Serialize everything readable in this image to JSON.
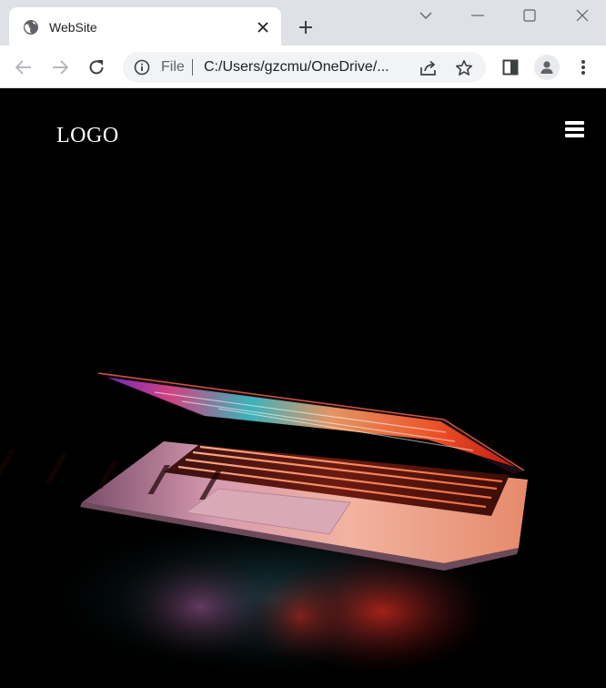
{
  "browser": {
    "tab_title": "WebSite",
    "omnibox_scheme": "File",
    "omnibox_url": "C:/Users/gzcmu/OneDrive/..."
  },
  "site": {
    "logo_text": "LOGO",
    "hero_image": "laptop glowing keyboard on black background"
  },
  "colors": {
    "tabbar_bg": "#dee1e6",
    "page_bg": "#000000",
    "logo_color": "#ffffff"
  }
}
